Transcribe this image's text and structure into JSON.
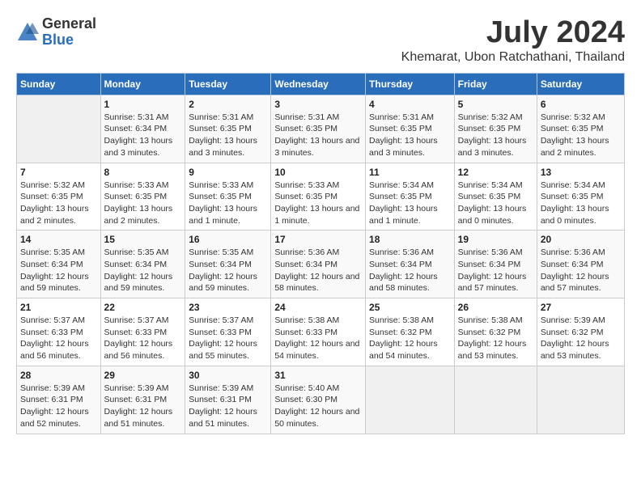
{
  "header": {
    "logo_general": "General",
    "logo_blue": "Blue",
    "title": "July 2024",
    "subtitle": "Khemarat, Ubon Ratchathani, Thailand"
  },
  "calendar": {
    "days_of_week": [
      "Sunday",
      "Monday",
      "Tuesday",
      "Wednesday",
      "Thursday",
      "Friday",
      "Saturday"
    ],
    "weeks": [
      [
        {
          "day": "",
          "sunrise": "",
          "sunset": "",
          "daylight": ""
        },
        {
          "day": "1",
          "sunrise": "Sunrise: 5:31 AM",
          "sunset": "Sunset: 6:34 PM",
          "daylight": "Daylight: 13 hours and 3 minutes."
        },
        {
          "day": "2",
          "sunrise": "Sunrise: 5:31 AM",
          "sunset": "Sunset: 6:35 PM",
          "daylight": "Daylight: 13 hours and 3 minutes."
        },
        {
          "day": "3",
          "sunrise": "Sunrise: 5:31 AM",
          "sunset": "Sunset: 6:35 PM",
          "daylight": "Daylight: 13 hours and 3 minutes."
        },
        {
          "day": "4",
          "sunrise": "Sunrise: 5:31 AM",
          "sunset": "Sunset: 6:35 PM",
          "daylight": "Daylight: 13 hours and 3 minutes."
        },
        {
          "day": "5",
          "sunrise": "Sunrise: 5:32 AM",
          "sunset": "Sunset: 6:35 PM",
          "daylight": "Daylight: 13 hours and 3 minutes."
        },
        {
          "day": "6",
          "sunrise": "Sunrise: 5:32 AM",
          "sunset": "Sunset: 6:35 PM",
          "daylight": "Daylight: 13 hours and 2 minutes."
        }
      ],
      [
        {
          "day": "7",
          "sunrise": "Sunrise: 5:32 AM",
          "sunset": "Sunset: 6:35 PM",
          "daylight": "Daylight: 13 hours and 2 minutes."
        },
        {
          "day": "8",
          "sunrise": "Sunrise: 5:33 AM",
          "sunset": "Sunset: 6:35 PM",
          "daylight": "Daylight: 13 hours and 2 minutes."
        },
        {
          "day": "9",
          "sunrise": "Sunrise: 5:33 AM",
          "sunset": "Sunset: 6:35 PM",
          "daylight": "Daylight: 13 hours and 1 minute."
        },
        {
          "day": "10",
          "sunrise": "Sunrise: 5:33 AM",
          "sunset": "Sunset: 6:35 PM",
          "daylight": "Daylight: 13 hours and 1 minute."
        },
        {
          "day": "11",
          "sunrise": "Sunrise: 5:34 AM",
          "sunset": "Sunset: 6:35 PM",
          "daylight": "Daylight: 13 hours and 1 minute."
        },
        {
          "day": "12",
          "sunrise": "Sunrise: 5:34 AM",
          "sunset": "Sunset: 6:35 PM",
          "daylight": "Daylight: 13 hours and 0 minutes."
        },
        {
          "day": "13",
          "sunrise": "Sunrise: 5:34 AM",
          "sunset": "Sunset: 6:35 PM",
          "daylight": "Daylight: 13 hours and 0 minutes."
        }
      ],
      [
        {
          "day": "14",
          "sunrise": "Sunrise: 5:35 AM",
          "sunset": "Sunset: 6:34 PM",
          "daylight": "Daylight: 12 hours and 59 minutes."
        },
        {
          "day": "15",
          "sunrise": "Sunrise: 5:35 AM",
          "sunset": "Sunset: 6:34 PM",
          "daylight": "Daylight: 12 hours and 59 minutes."
        },
        {
          "day": "16",
          "sunrise": "Sunrise: 5:35 AM",
          "sunset": "Sunset: 6:34 PM",
          "daylight": "Daylight: 12 hours and 59 minutes."
        },
        {
          "day": "17",
          "sunrise": "Sunrise: 5:36 AM",
          "sunset": "Sunset: 6:34 PM",
          "daylight": "Daylight: 12 hours and 58 minutes."
        },
        {
          "day": "18",
          "sunrise": "Sunrise: 5:36 AM",
          "sunset": "Sunset: 6:34 PM",
          "daylight": "Daylight: 12 hours and 58 minutes."
        },
        {
          "day": "19",
          "sunrise": "Sunrise: 5:36 AM",
          "sunset": "Sunset: 6:34 PM",
          "daylight": "Daylight: 12 hours and 57 minutes."
        },
        {
          "day": "20",
          "sunrise": "Sunrise: 5:36 AM",
          "sunset": "Sunset: 6:34 PM",
          "daylight": "Daylight: 12 hours and 57 minutes."
        }
      ],
      [
        {
          "day": "21",
          "sunrise": "Sunrise: 5:37 AM",
          "sunset": "Sunset: 6:33 PM",
          "daylight": "Daylight: 12 hours and 56 minutes."
        },
        {
          "day": "22",
          "sunrise": "Sunrise: 5:37 AM",
          "sunset": "Sunset: 6:33 PM",
          "daylight": "Daylight: 12 hours and 56 minutes."
        },
        {
          "day": "23",
          "sunrise": "Sunrise: 5:37 AM",
          "sunset": "Sunset: 6:33 PM",
          "daylight": "Daylight: 12 hours and 55 minutes."
        },
        {
          "day": "24",
          "sunrise": "Sunrise: 5:38 AM",
          "sunset": "Sunset: 6:33 PM",
          "daylight": "Daylight: 12 hours and 54 minutes."
        },
        {
          "day": "25",
          "sunrise": "Sunrise: 5:38 AM",
          "sunset": "Sunset: 6:32 PM",
          "daylight": "Daylight: 12 hours and 54 minutes."
        },
        {
          "day": "26",
          "sunrise": "Sunrise: 5:38 AM",
          "sunset": "Sunset: 6:32 PM",
          "daylight": "Daylight: 12 hours and 53 minutes."
        },
        {
          "day": "27",
          "sunrise": "Sunrise: 5:39 AM",
          "sunset": "Sunset: 6:32 PM",
          "daylight": "Daylight: 12 hours and 53 minutes."
        }
      ],
      [
        {
          "day": "28",
          "sunrise": "Sunrise: 5:39 AM",
          "sunset": "Sunset: 6:31 PM",
          "daylight": "Daylight: 12 hours and 52 minutes."
        },
        {
          "day": "29",
          "sunrise": "Sunrise: 5:39 AM",
          "sunset": "Sunset: 6:31 PM",
          "daylight": "Daylight: 12 hours and 51 minutes."
        },
        {
          "day": "30",
          "sunrise": "Sunrise: 5:39 AM",
          "sunset": "Sunset: 6:31 PM",
          "daylight": "Daylight: 12 hours and 51 minutes."
        },
        {
          "day": "31",
          "sunrise": "Sunrise: 5:40 AM",
          "sunset": "Sunset: 6:30 PM",
          "daylight": "Daylight: 12 hours and 50 minutes."
        },
        {
          "day": "",
          "sunrise": "",
          "sunset": "",
          "daylight": ""
        },
        {
          "day": "",
          "sunrise": "",
          "sunset": "",
          "daylight": ""
        },
        {
          "day": "",
          "sunrise": "",
          "sunset": "",
          "daylight": ""
        }
      ]
    ]
  }
}
